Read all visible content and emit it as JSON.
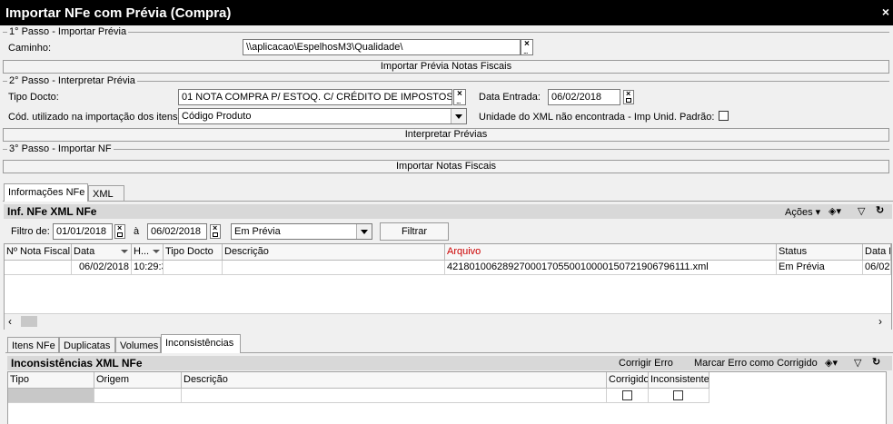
{
  "window": {
    "title": "Importar NFe com Prévia (Compra)",
    "close": "×"
  },
  "step1": {
    "legend": "1° Passo - Importar Prévia",
    "path_label": "Caminho:",
    "path_value": "\\\\aplicacao\\EspelhosM3\\Qualidade\\",
    "button": "Importar Prévia Notas Fiscais"
  },
  "step2": {
    "legend": "2° Passo - Interpretar Prévia",
    "tipo_label": "Tipo Docto:",
    "tipo_value": "01 NOTA COMPRA P/ ESTOQ. C/ CRÉDITO DE IMPOSTOS",
    "data_label": "Data Entrada:",
    "data_value": "06/02/2018",
    "cod_label": "Cód. utilizado na importação dos itens:",
    "cod_value": "Código Produto",
    "unidade_label": "Unidade do XML não encontrada - Imp Unid. Padrão:",
    "button": "Interpretar Prévias"
  },
  "step3": {
    "legend": "3° Passo - Importar NF",
    "button": "Importar Notas Fiscais"
  },
  "tabs_top": [
    "Informações NFe",
    "XML"
  ],
  "nfe_panel": {
    "title": "Inf. NFe XML NFe",
    "acoes": "Ações",
    "filtro_label": "Filtro de:",
    "date_from": "01/01/2018",
    "a_label": "à",
    "date_to": "06/02/2018",
    "status_filter": "Em Prévia",
    "filtrar": "Filtrar",
    "columns": [
      "Nº Nota Fiscal",
      "Data",
      "H...",
      "Tipo Docto",
      "Descrição",
      "Arquivo",
      "Status",
      "Data E"
    ],
    "rows": [
      [
        "",
        "06/02/2018",
        "10:29:3",
        "",
        "",
        "42180100628927000170550010000150721906796111.xml",
        "Em Prévia",
        "06/02"
      ]
    ]
  },
  "tabs_bottom": [
    "Itens NFe",
    "Duplicatas",
    "Volumes",
    "Inconsistências"
  ],
  "inc_panel": {
    "title": "Inconsistências XML NFe",
    "corrigir": "Corrigir Erro",
    "marcar": "Marcar Erro como Corrigido",
    "columns": [
      "Tipo",
      "Origem",
      "Descrição",
      "Corrigido",
      "Inconsistente"
    ]
  },
  "colors": {
    "arquivo_header": "#cc0000",
    "titlebar": "#000000"
  }
}
